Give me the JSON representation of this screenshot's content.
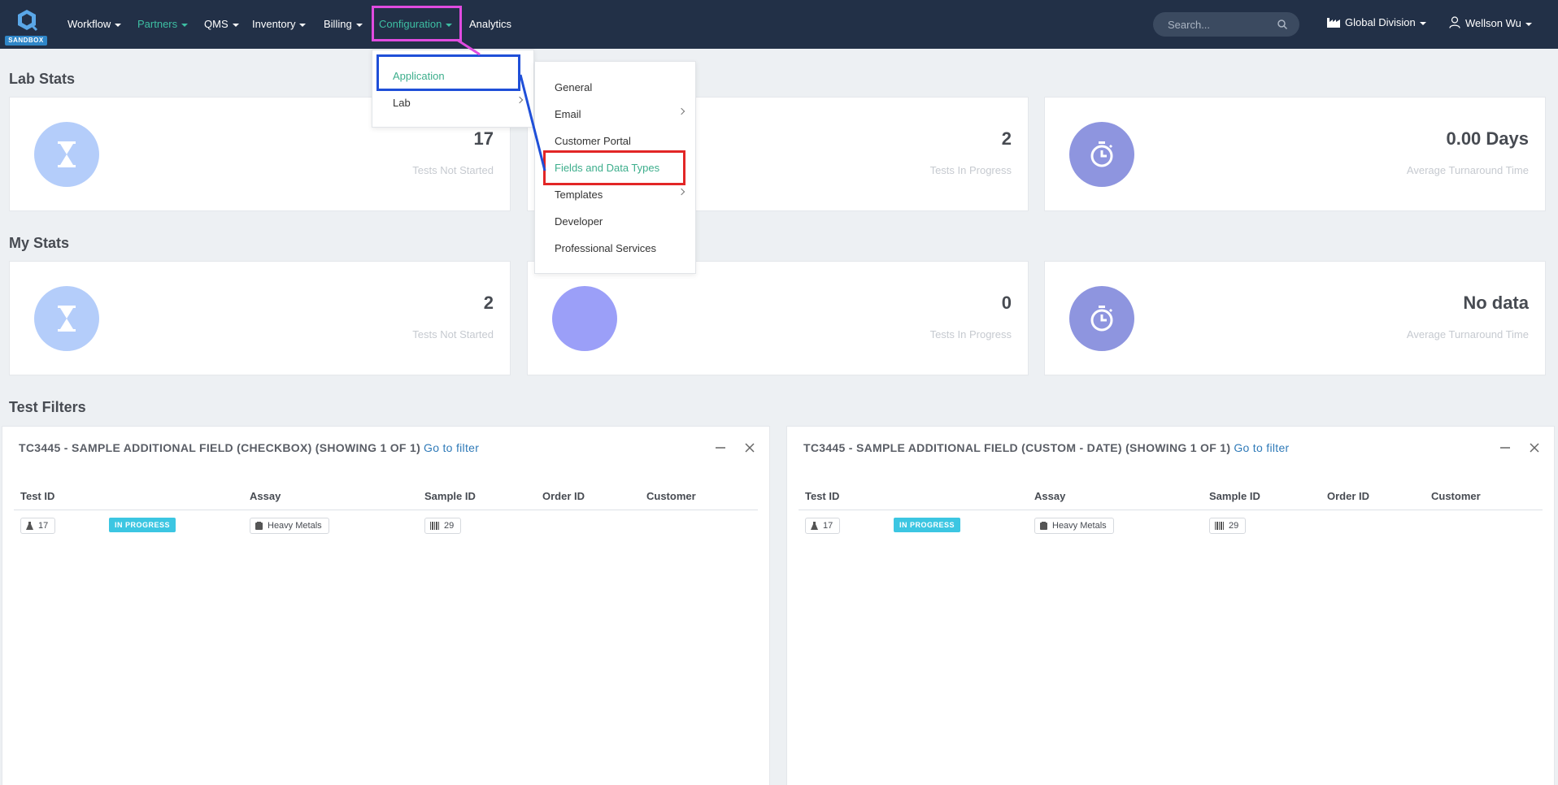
{
  "nav": {
    "logo_badge": "SANDBOX",
    "items": [
      {
        "label": "Workflow"
      },
      {
        "label": "Partners"
      },
      {
        "label": "QMS"
      },
      {
        "label": "Inventory"
      },
      {
        "label": "Billing"
      },
      {
        "label": "Configuration"
      },
      {
        "label": "Analytics"
      }
    ],
    "search_placeholder": "Search...",
    "division": "Global Division",
    "user": "Wellson Wu",
    "colors": {
      "bg": "#223047",
      "active": "#3dbfa3"
    }
  },
  "config_menu": {
    "items": [
      {
        "label": "Application"
      },
      {
        "label": "Lab"
      }
    ]
  },
  "application_submenu": {
    "items": [
      {
        "label": "General"
      },
      {
        "label": "Email"
      },
      {
        "label": "Customer Portal"
      },
      {
        "label": "Fields and Data Types"
      },
      {
        "label": "Templates"
      },
      {
        "label": "Developer"
      },
      {
        "label": "Professional Services"
      }
    ]
  },
  "lab_stats": {
    "title": "Lab Stats",
    "cards": [
      {
        "value": "17",
        "label": "Tests Not Started",
        "icon": "hourglass-icon"
      },
      {
        "value": "2",
        "label": "Tests In Progress",
        "icon": "none"
      },
      {
        "value": "0.00 Days",
        "label": "Average Turnaround Time",
        "icon": "stopwatch-icon"
      }
    ]
  },
  "my_stats": {
    "title": "My Stats",
    "cards": [
      {
        "value": "2",
        "label": "Tests Not Started",
        "icon": "hourglass-icon"
      },
      {
        "value": "0",
        "label": "Tests In Progress",
        "icon": "none"
      },
      {
        "value": "No data",
        "label": "Average Turnaround Time",
        "icon": "stopwatch-icon"
      }
    ]
  },
  "test_filters": {
    "title": "Test Filters",
    "panels": [
      {
        "title": "TC3445 - SAMPLE ADDITIONAL FIELD (CHECKBOX) (SHOWING 1 OF 1)",
        "link": "Go to filter",
        "columns": [
          "Test ID",
          "Assay",
          "Sample ID",
          "Order ID",
          "Customer"
        ],
        "rows": [
          {
            "test_id": "17",
            "status": "IN PROGRESS",
            "assay": "Heavy Metals",
            "sample_id": "29"
          }
        ]
      },
      {
        "title": "TC3445 - SAMPLE ADDITIONAL FIELD (CUSTOM - DATE) (SHOWING 1 OF 1)",
        "link": "Go to filter",
        "columns": [
          "Test ID",
          "Assay",
          "Sample ID",
          "Order ID",
          "Customer"
        ],
        "rows": [
          {
            "test_id": "17",
            "status": "IN PROGRESS",
            "assay": "Heavy Metals",
            "sample_id": "29"
          }
        ]
      }
    ]
  }
}
